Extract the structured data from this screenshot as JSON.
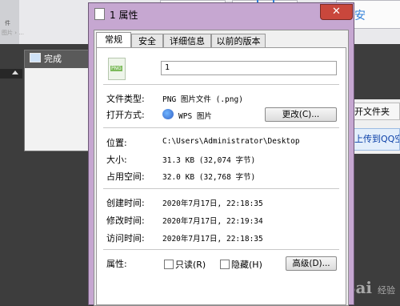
{
  "background": {
    "path_text": "图片 › ...",
    "left_snippet": "件",
    "tile_char": "安",
    "done_title": "完成",
    "right_button1": "开文件夹",
    "right_button2": "上传到QQ空",
    "watermark": "Bai",
    "watermark_suffix": "经验"
  },
  "dialog": {
    "title": "1 属性",
    "close_glyph": "✕",
    "tabs": [
      "常规",
      "安全",
      "详细信息",
      "以前的版本"
    ],
    "filename": "1",
    "file_icon_text": "PNG",
    "rows": {
      "type_label": "文件类型:",
      "type_value": "PNG 图片文件 (.png)",
      "open_label": "打开方式:",
      "open_value": "WPS 图片",
      "change_button": "更改(C)...",
      "location_label": "位置:",
      "location_value": "C:\\Users\\Administrator\\Desktop",
      "size_label": "大小:",
      "size_value": "31.3 KB (32,074 字节)",
      "disk_label": "占用空间:",
      "disk_value": "32.0 KB (32,768 字节)",
      "created_label": "创建时间:",
      "created_value": "2020年7月17日, 22:18:35",
      "modified_label": "修改时间:",
      "modified_value": "2020年7月17日, 22:19:34",
      "accessed_label": "访问时间:",
      "accessed_value": "2020年7月17日, 22:18:35",
      "attr_label": "属性:",
      "readonly_label": "只读(R)",
      "hidden_label": "隐藏(H)",
      "advanced_button": "高级(D)..."
    }
  },
  "colors": {
    "title_tint": "#c6a7d1",
    "close_red": "#c9473c"
  }
}
